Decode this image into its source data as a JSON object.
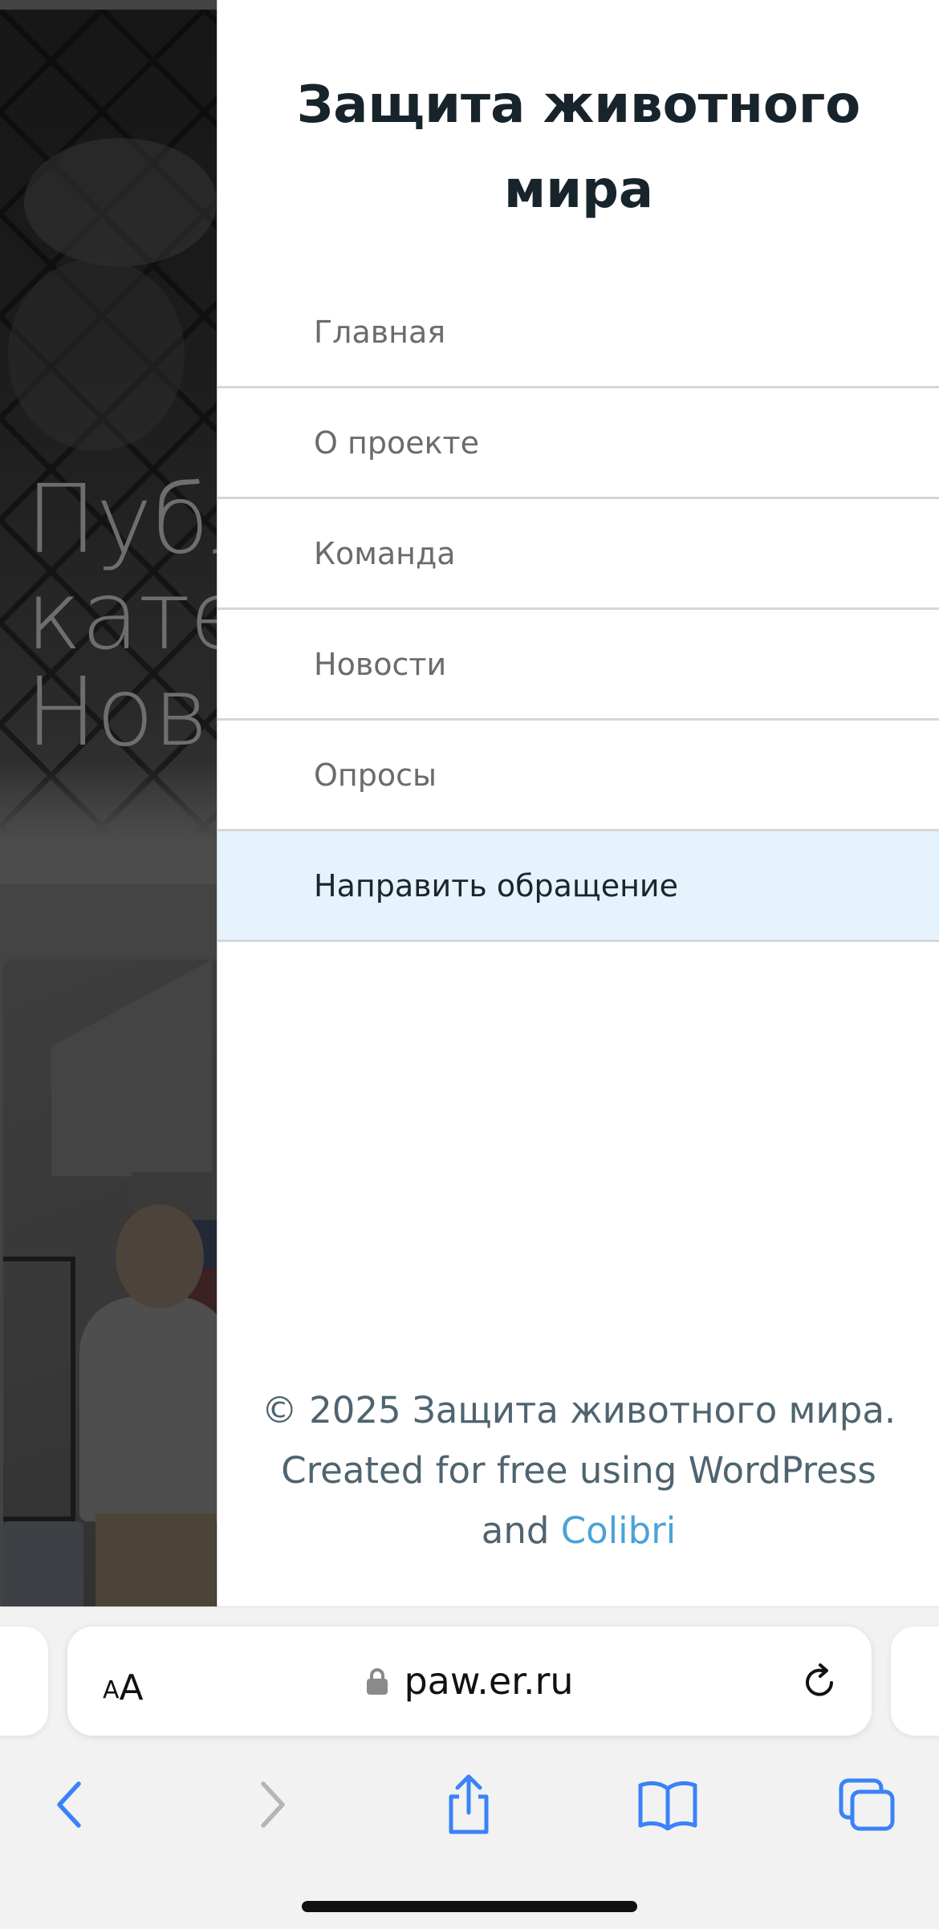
{
  "background_page": {
    "hero_title_lines": [
      "Публ",
      "кате",
      "Нов"
    ]
  },
  "drawer": {
    "title": "Защита животного мира",
    "menu": [
      {
        "label": "Главная",
        "active": false
      },
      {
        "label": "О проекте",
        "active": false
      },
      {
        "label": "Команда",
        "active": false
      },
      {
        "label": "Новости",
        "active": false
      },
      {
        "label": "Опросы",
        "active": false
      },
      {
        "label": "Направить обращение",
        "active": true
      }
    ],
    "footer": {
      "line1": "© 2025 Защита животного мира.",
      "line2": "Created for free using WordPress",
      "line3_prefix": "and ",
      "link_label": "Colibri"
    }
  },
  "browser": {
    "text_size_button": {
      "small": "A",
      "big": "A"
    },
    "url": "paw.er.ru",
    "icons": {
      "lock": "lock-icon",
      "reload": "reload-icon",
      "back": "chevron-left-icon",
      "forward": "chevron-right-icon",
      "share": "share-icon",
      "bookmarks": "book-icon",
      "tabs": "tabs-icon"
    },
    "colors": {
      "accent": "#3a82f7",
      "disabled": "#b5b5b5",
      "link": "#4aa3d6",
      "active_menu_bg": "#e6f3fc"
    }
  }
}
